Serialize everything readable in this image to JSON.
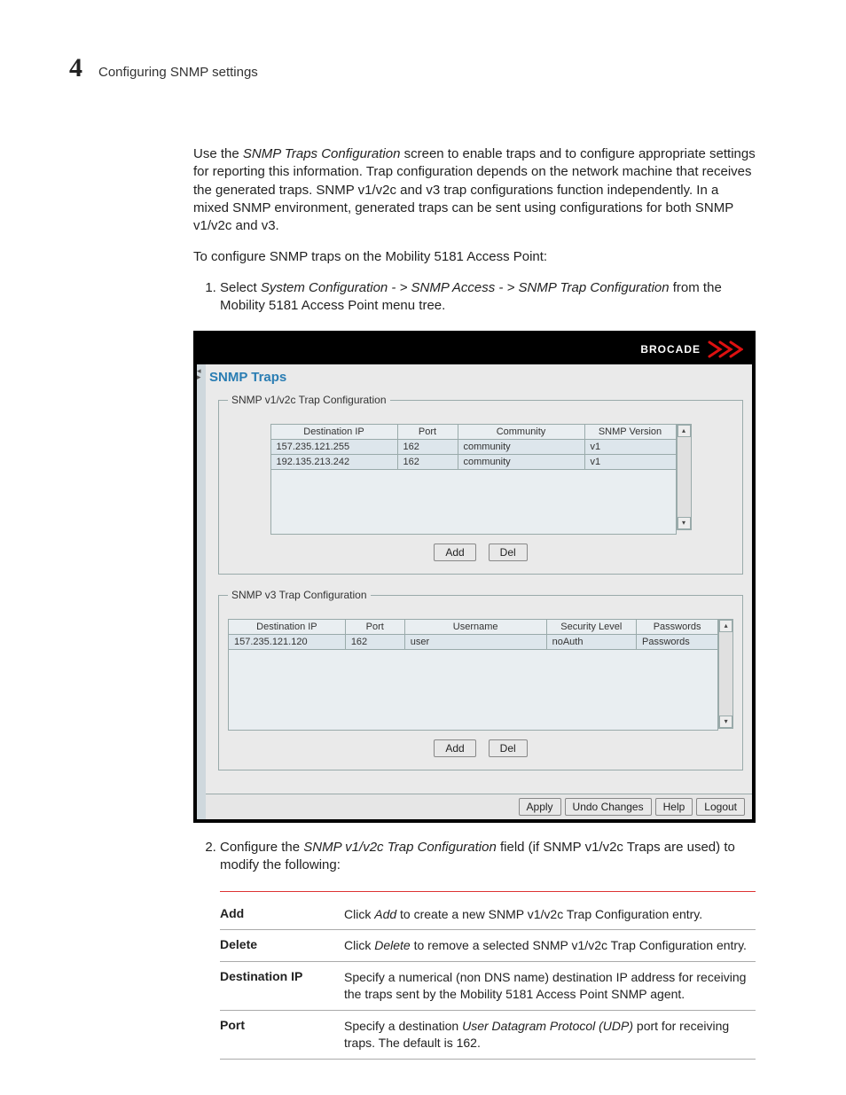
{
  "header": {
    "chapter_number": "4",
    "section_title": "Configuring SNMP settings"
  },
  "intro_paragraph": {
    "pre": "Use the ",
    "em": "SNMP Traps Configuration",
    "post": " screen to enable traps and to configure appropriate settings for reporting this information. Trap configuration depends on the network machine that receives the generated traps. SNMP v1/v2c and v3 trap configurations function independently. In a mixed SNMP environment, generated traps can be sent using configurations for both SNMP v1/v2c and v3."
  },
  "lead_line": "To configure SNMP traps on the Mobility 5181 Access Point:",
  "steps": {
    "step1": {
      "pre": "Select ",
      "em": "System Configuration - > SNMP Access - > SNMP Trap Configuration",
      "post": " from the Mobility 5181 Access Point menu tree."
    },
    "step2": {
      "pre": "Configure the ",
      "em": "SNMP v1/v2c Trap Configuration",
      "post": " field (if SNMP v1/v2c Traps are used) to modify the following:"
    }
  },
  "screenshot": {
    "brand": "BROCADE",
    "panel_title": "SNMP Traps",
    "fieldset1": {
      "legend": "SNMP v1/v2c Trap Configuration",
      "columns": {
        "dest_ip": "Destination IP",
        "port": "Port",
        "community": "Community",
        "version": "SNMP Version"
      },
      "rows": [
        {
          "dest_ip": "157.235.121.255",
          "port": "162",
          "community": "community",
          "version": "v1"
        },
        {
          "dest_ip": "192.135.213.242",
          "port": "162",
          "community": "community",
          "version": "v1"
        }
      ],
      "buttons": {
        "add": "Add",
        "del": "Del"
      }
    },
    "fieldset2": {
      "legend": "SNMP v3 Trap Configuration",
      "columns": {
        "dest_ip": "Destination IP",
        "port": "Port",
        "username": "Username",
        "security": "Security Level",
        "passwords": "Passwords"
      },
      "rows": [
        {
          "dest_ip": "157.235.121.120",
          "port": "162",
          "username": "user",
          "security": "noAuth",
          "passwords": "Passwords"
        }
      ],
      "buttons": {
        "add": "Add",
        "del": "Del"
      }
    },
    "footer": {
      "apply": "Apply",
      "undo": "Undo Changes",
      "help": "Help",
      "logout": "Logout"
    }
  },
  "definitions": [
    {
      "term": "Add",
      "desc_pre": "Click ",
      "desc_em": "Add",
      "desc_post": " to create a new SNMP v1/v2c Trap Configuration entry."
    },
    {
      "term": "Delete",
      "desc_pre": "Click ",
      "desc_em": "Delete",
      "desc_post": " to remove a selected SNMP v1/v2c Trap Configuration entry."
    },
    {
      "term": "Destination IP",
      "desc_pre": "",
      "desc_em": "",
      "desc_post": "Specify a numerical (non DNS name) destination IP address for receiving the traps sent by the Mobility 5181 Access Point SNMP agent."
    },
    {
      "term": "Port",
      "desc_pre": "Specify a destination ",
      "desc_em": "User Datagram Protocol (UDP)",
      "desc_post": " port for receiving traps. The default is 162."
    }
  ]
}
